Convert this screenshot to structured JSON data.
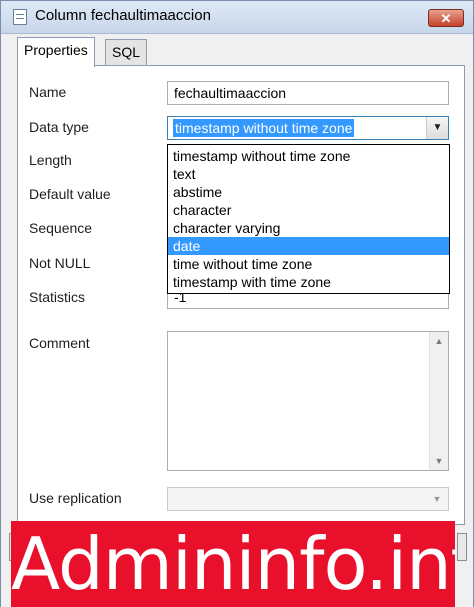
{
  "window": {
    "title": "Column fechaultimaaccion",
    "close_glyph": "✕"
  },
  "tabs": [
    {
      "label": "Properties",
      "active": true
    },
    {
      "label": "SQL",
      "active": false
    }
  ],
  "fields": {
    "name": {
      "label": "Name",
      "value": "fechaultimaaccion"
    },
    "data_type": {
      "label": "Data type",
      "value": "timestamp without time zone"
    },
    "length": {
      "label": "Length"
    },
    "default_value": {
      "label": "Default value"
    },
    "sequence": {
      "label": "Sequence"
    },
    "not_null": {
      "label": "Not NULL"
    },
    "statistics": {
      "label": "Statistics",
      "value": "-1"
    },
    "comment": {
      "label": "Comment"
    },
    "use_replication": {
      "label": "Use replication"
    }
  },
  "dropdown": {
    "options": [
      "timestamp without time zone",
      "text",
      "abstime",
      "character",
      "character varying",
      "date",
      "time without time zone",
      "timestamp with time zone"
    ],
    "selected_index": 5
  },
  "icons": {
    "combo_arrow": "▼",
    "scroll_up": "▲",
    "scroll_down": "▼"
  },
  "watermark": {
    "text": "Admininfo.info"
  },
  "colors": {
    "selection": "#3399ff",
    "watermark_bg": "#e8102a"
  }
}
